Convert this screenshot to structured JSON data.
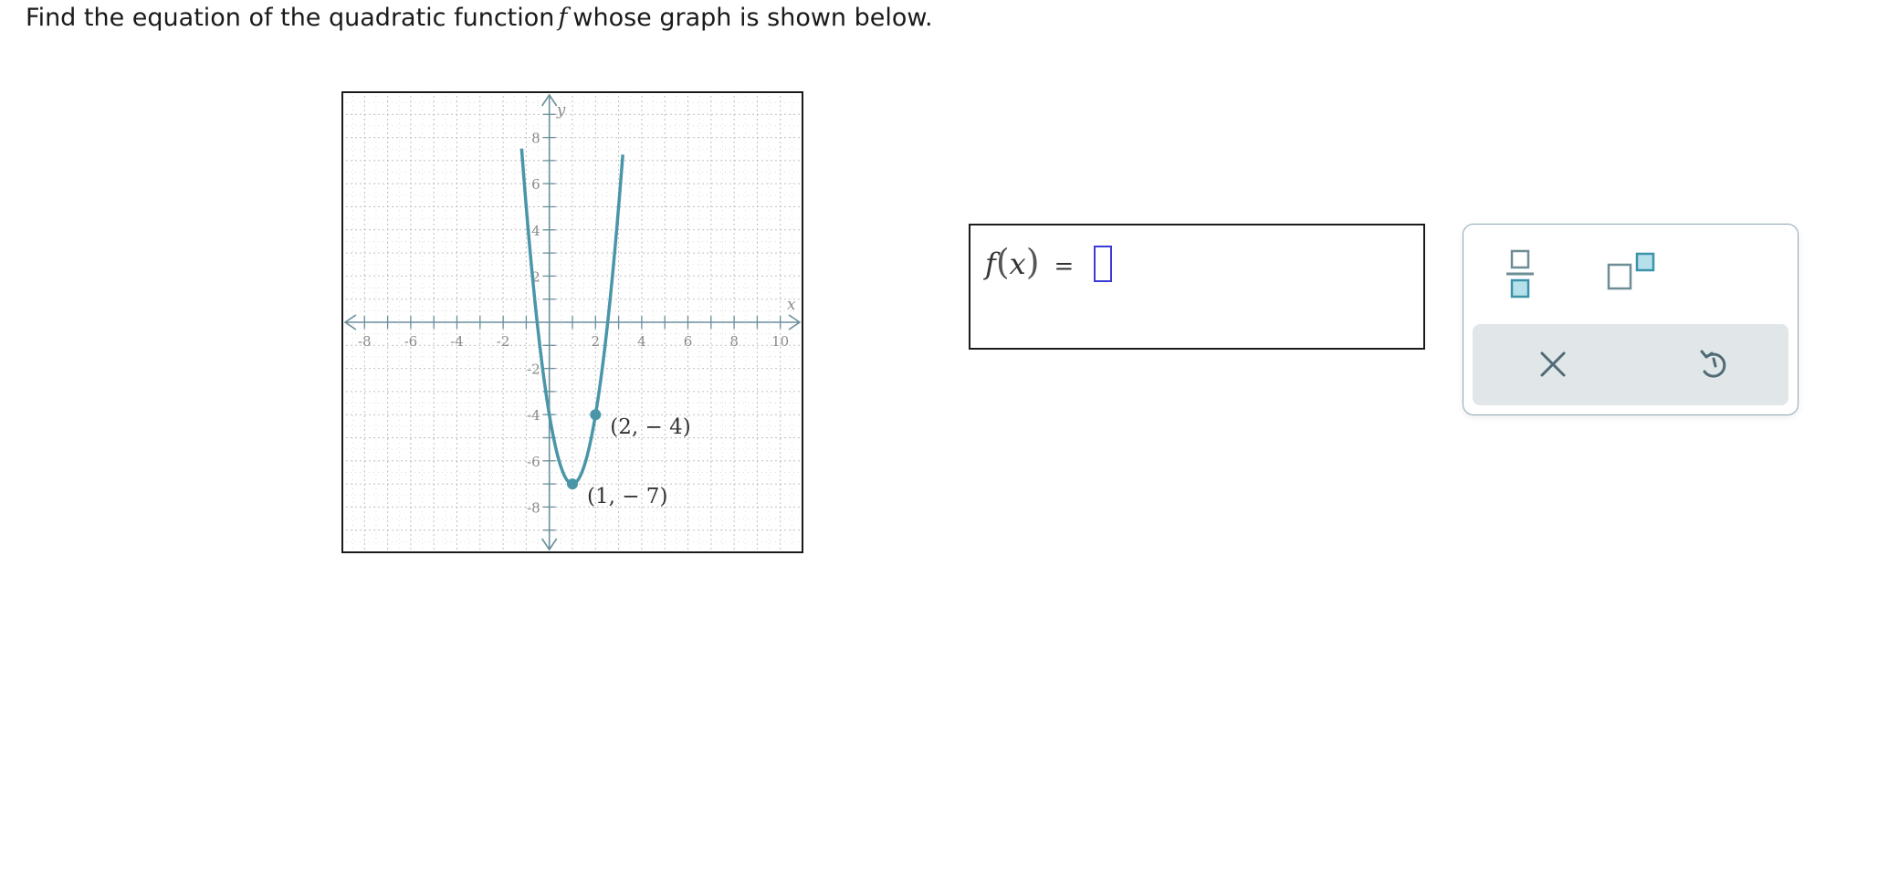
{
  "question": {
    "before": "Find the equation of the quadratic function",
    "variable": "f",
    "after": "whose graph is shown below."
  },
  "graph": {
    "x_axis_label": "x",
    "y_axis_label": "y",
    "x_tick_labels": [
      "-8",
      "-6",
      "-4",
      "-2",
      "2",
      "4",
      "6",
      "8",
      "10"
    ],
    "y_tick_labels": [
      "8",
      "6",
      "4",
      "2",
      "-2",
      "-4",
      "-6",
      "-8"
    ],
    "x_range": [
      -9,
      11
    ],
    "y_range": [
      -10,
      10
    ],
    "grid": true,
    "curve": {
      "type": "parabola",
      "vertex": [
        1,
        -7
      ],
      "a": 3
    },
    "points": [
      {
        "x": 2,
        "y": -4,
        "label": "(2, − 4)"
      },
      {
        "x": 1,
        "y": -7,
        "label": "(1, − 7)"
      }
    ],
    "colors": {
      "curve": "#4a96a8",
      "axis": "#6a8f9c",
      "grid": "#b9b9b9",
      "tick_text": "#8a8a8a"
    }
  },
  "answer": {
    "function_name": "f",
    "variable": "x",
    "equals": "="
  },
  "toolbar": {
    "tools": [
      {
        "name": "fraction-button",
        "icon": "fraction-icon"
      },
      {
        "name": "exponent-button",
        "icon": "exponent-icon"
      }
    ],
    "actions": [
      {
        "name": "clear-button",
        "icon": "x-icon"
      },
      {
        "name": "undo-button",
        "icon": "undo-icon"
      }
    ],
    "colors": {
      "icon": "#6e8c96",
      "accent_fill": "#b6e0ea",
      "accent_stroke": "#3a93ab",
      "action_bg": "#e1e6e9"
    }
  }
}
